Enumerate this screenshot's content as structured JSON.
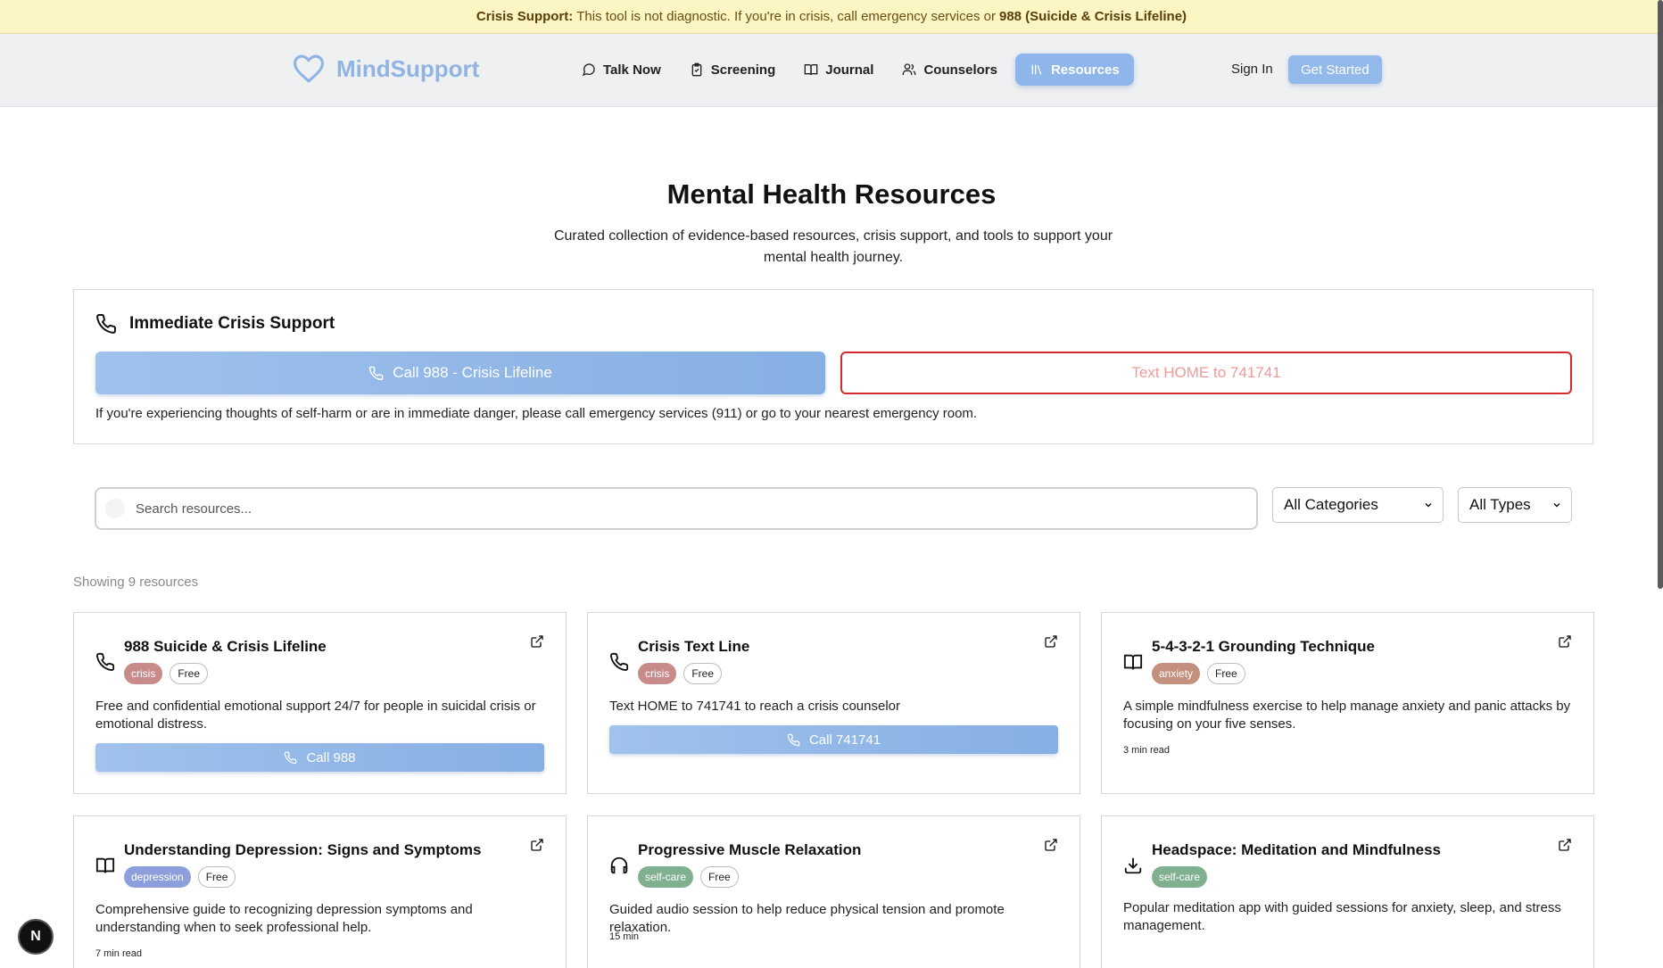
{
  "banner": {
    "label": "Crisis Support:",
    "text": "This tool is not diagnostic. If you're in crisis, call emergency services or",
    "hotline": "988 (Suicide & Crisis Lifeline)"
  },
  "header": {
    "brand": "MindSupport",
    "nav": [
      {
        "label": "Talk Now",
        "icon": "chat-icon"
      },
      {
        "label": "Screening",
        "icon": "clipboard-icon"
      },
      {
        "label": "Journal",
        "icon": "book-icon"
      },
      {
        "label": "Counselors",
        "icon": "users-icon"
      },
      {
        "label": "Resources",
        "icon": "library-icon",
        "active": true
      }
    ],
    "sign_in": "Sign In",
    "get_started": "Get Started"
  },
  "hero": {
    "title": "Mental Health Resources",
    "subtitle": "Curated collection of evidence-based resources, crisis support, and tools to support your mental health journey."
  },
  "crisis": {
    "heading": "Immediate Crisis Support",
    "call_label": "Call 988 - Crisis Lifeline",
    "text_label": "Text HOME to 741741",
    "note": "If you're experiencing thoughts of self-harm or are in immediate danger, please call emergency services (911) or go to your nearest emergency room."
  },
  "filters": {
    "search_placeholder": "Search resources...",
    "category": "All Categories",
    "type": "All Types"
  },
  "results_count": "Showing 9 resources",
  "resources": [
    {
      "title": "988 Suicide & Crisis Lifeline",
      "icon": "phone-icon",
      "category": "crisis",
      "price": "Free",
      "desc": "Free and confidential emotional support 24/7 for people in suicidal crisis or emotional distress.",
      "action": "Call 988"
    },
    {
      "title": "Crisis Text Line",
      "icon": "phone-icon",
      "category": "crisis",
      "price": "Free",
      "desc": "Text HOME to 741741 to reach a crisis counselor",
      "action": "Call 741741"
    },
    {
      "title": "5-4-3-2-1 Grounding Technique",
      "icon": "book-icon",
      "category": "anxiety",
      "price": "Free",
      "desc": "A simple mindfulness exercise to help manage anxiety and panic attacks by focusing on your five senses.",
      "meta": "3 min read"
    },
    {
      "title": "Understanding Depression: Signs and Symptoms",
      "icon": "book-icon",
      "category": "depression",
      "price": "Free",
      "desc": "Comprehensive guide to recognizing depression symptoms and understanding when to seek professional help.",
      "meta": "7 min read"
    },
    {
      "title": "Progressive Muscle Relaxation",
      "icon": "headphones-icon",
      "category": "self-care",
      "price": "Free",
      "desc": "Guided audio session to help reduce physical tension and promote relaxation.",
      "meta": "15 min"
    },
    {
      "title": "Headspace: Meditation and Mindfulness",
      "icon": "download-icon",
      "category": "self-care",
      "desc": "Popular meditation app with guided sessions for anxiety, sleep, and stress management."
    }
  ],
  "colors": {
    "crisis": "#c98a8a",
    "anxiety": "#c4907e",
    "depression": "#8c9fdc",
    "self-care": "#7fb08f",
    "accent": "#8fb6ea",
    "danger": "#d12b2b"
  },
  "floating_badge": "N"
}
